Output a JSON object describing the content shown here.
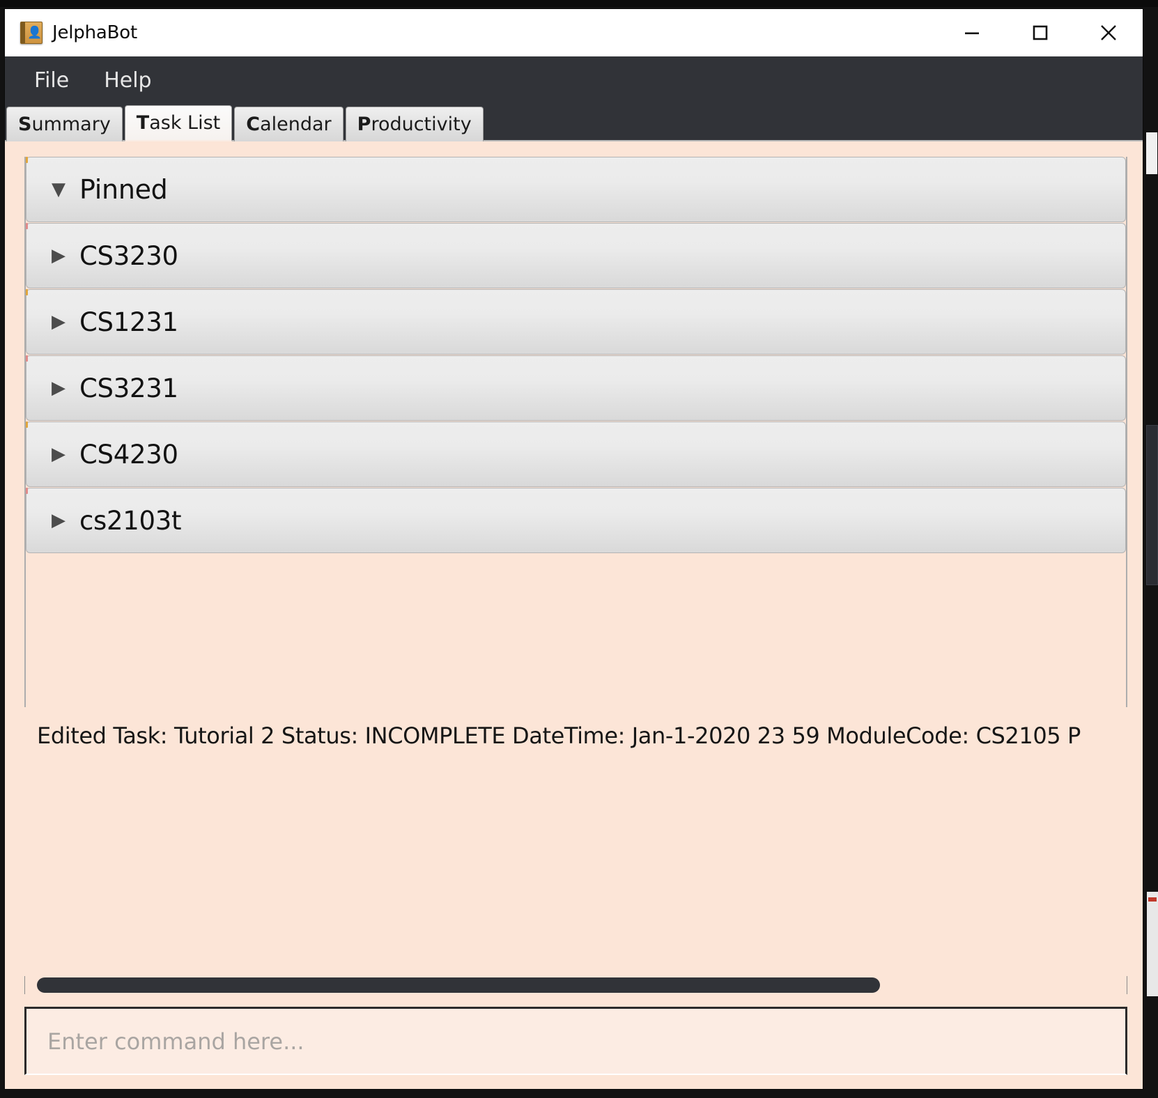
{
  "window": {
    "title": "JelphaBot",
    "icon": "address-book-person-icon",
    "controls": {
      "minimize": "minimize-icon",
      "maximize": "maximize-icon",
      "close": "close-icon"
    }
  },
  "menu": {
    "items": [
      {
        "label": "File"
      },
      {
        "label": "Help"
      }
    ]
  },
  "tabs": [
    {
      "mnemonic": "S",
      "rest": "ummary",
      "label": "Summary",
      "active": false
    },
    {
      "mnemonic": "T",
      "rest": "ask List",
      "label": "Task List",
      "active": true
    },
    {
      "mnemonic": "C",
      "rest": "alendar",
      "label": "Calendar",
      "active": false
    },
    {
      "mnemonic": "P",
      "rest": "roductivity",
      "label": "Productivity",
      "active": false
    }
  ],
  "task_list": {
    "groups": [
      {
        "label": "Pinned",
        "expanded": true,
        "arrow": "triangle-down-icon",
        "accent": "#e0a53c"
      },
      {
        "label": "CS3230",
        "expanded": false,
        "arrow": "triangle-right-icon",
        "accent": "#e08a8a"
      },
      {
        "label": "CS1231",
        "expanded": false,
        "arrow": "triangle-right-icon",
        "accent": "#e0a53c"
      },
      {
        "label": "CS3231",
        "expanded": false,
        "arrow": "triangle-right-icon",
        "accent": "#e08a8a"
      },
      {
        "label": "CS4230",
        "expanded": false,
        "arrow": "triangle-right-icon",
        "accent": "#e0a53c"
      },
      {
        "label": "cs2103t",
        "expanded": false,
        "arrow": "triangle-right-icon",
        "accent": "#e08a8a"
      }
    ]
  },
  "result": {
    "text": "Edited Task: Tutorial 2 Status: INCOMPLETE DateTime: Jan-1-2020 23 59 ModuleCode: CS2105 P"
  },
  "command": {
    "value": "",
    "placeholder": "Enter command here..."
  },
  "colors": {
    "window_background": "#fce5d7",
    "menu_bar": "#313338",
    "title_bar": "#ffffff",
    "scrollbar_thumb": "#313338",
    "accordion_border": "#b4b4b4"
  }
}
